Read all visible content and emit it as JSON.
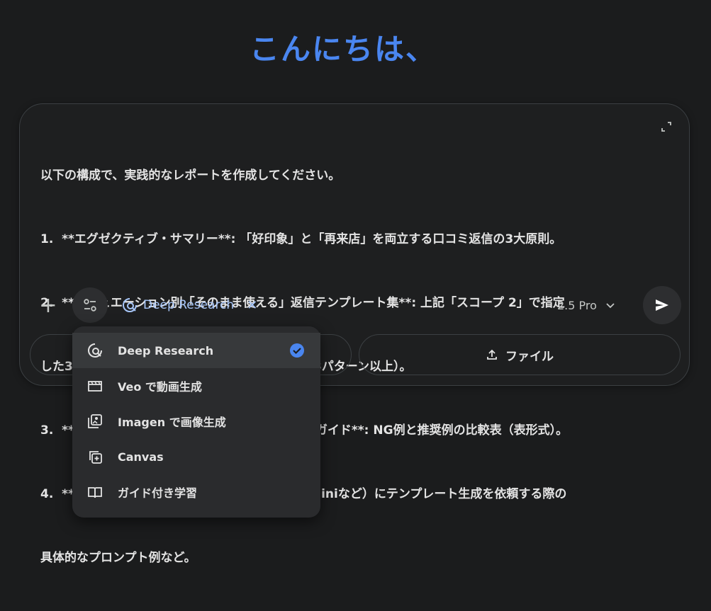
{
  "greeting": "こんにちは、",
  "prompt": {
    "lines": [
      "以下の構成で、実践的なレポートを作成してください。",
      "1.  **エグゼクティブ・サマリー**: 「好印象」と「再来店」を両立する口コミ返信の3大原則。",
      "2.  **シチュエーション別「そのまま使える」返信テンプレート集**: 上記「スコープ 2」で指定",
      "した3つのシチュエーション別のテンプレート（各3パターン以上）。",
      "3.  **「押し付けがましさ」回避のための言葉選びガイド**: NG例と推奨例の比較表（表形式）。",
      "4.  **効率化のための実践テクニック**: AI（Geminiなど）にテンプレート生成を依頼する際の",
      "具体的なプロンプト例など。"
    ]
  },
  "toolbar": {
    "plus": "+",
    "active_tool": "Deep Research",
    "close": "✕",
    "model": "2.5 Pro",
    "file_button": "ファイル"
  },
  "menu": {
    "items": [
      {
        "label": "Deep Research",
        "icon": "deep-research-icon",
        "selected": true
      },
      {
        "label": "Veo で動画生成",
        "icon": "video-clapper-icon"
      },
      {
        "label": "Imagen で画像生成",
        "icon": "image-gallery-icon"
      },
      {
        "label": "Canvas",
        "icon": "canvas-icon"
      },
      {
        "label": "ガイド付き学習",
        "icon": "book-icon"
      }
    ]
  },
  "colors": {
    "accent": "#4a86f0",
    "chip": "#a8c7fa",
    "background": "#1b1c1d",
    "check": "#4a86f0"
  }
}
